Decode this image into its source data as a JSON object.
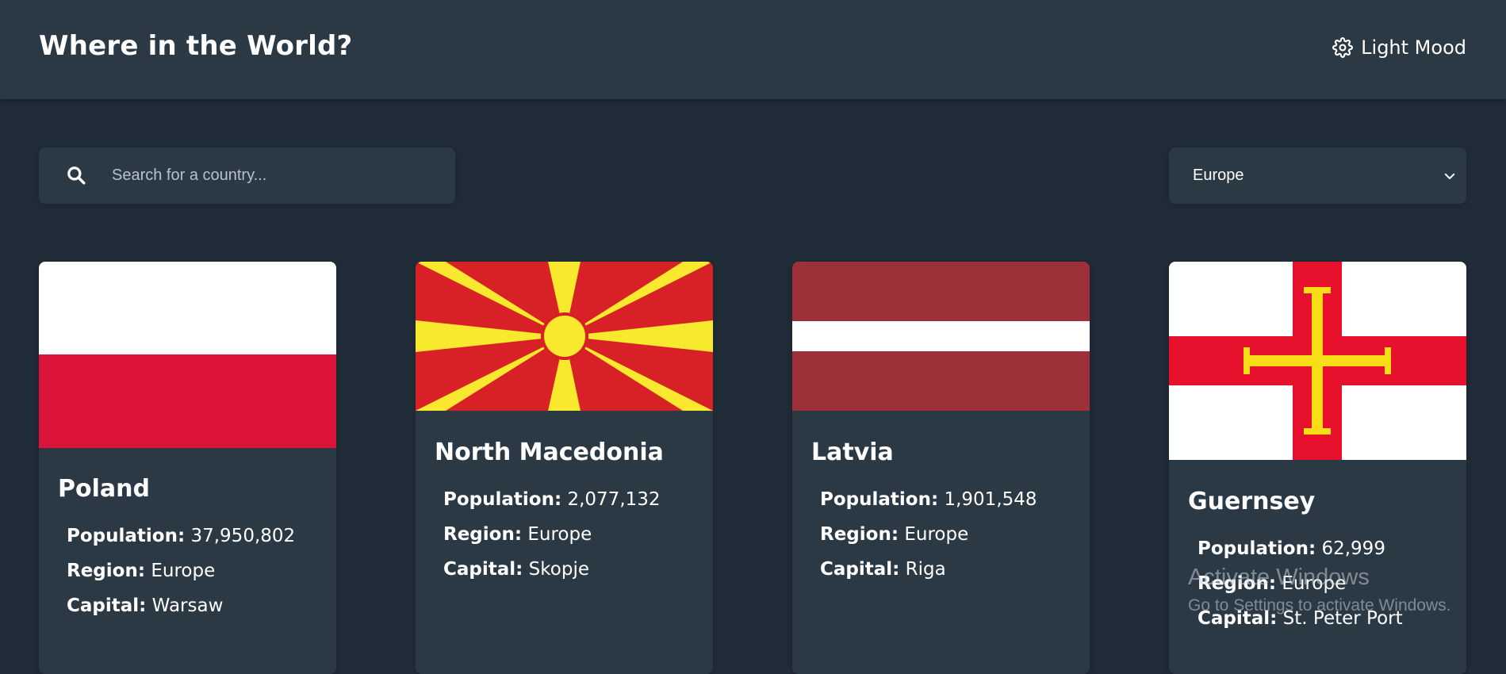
{
  "header": {
    "title": "Where in the World?",
    "mode_toggle_label": "Light Mood",
    "mode_toggle_icon": "gear-icon"
  },
  "search": {
    "placeholder": "Search for a country...",
    "value": "",
    "icon": "search-icon"
  },
  "filter": {
    "selected": "Europe",
    "icon": "chevron-down-icon"
  },
  "labels": {
    "population": "Population:",
    "region": "Region:",
    "capital": "Capital:"
  },
  "countries": [
    {
      "name": "Poland",
      "population": "37,950,802",
      "region": "Europe",
      "capital": "Warsaw"
    },
    {
      "name": "North Macedonia",
      "population": "2,077,132",
      "region": "Europe",
      "capital": "Skopje"
    },
    {
      "name": "Latvia",
      "population": "1,901,548",
      "region": "Europe",
      "capital": "Riga"
    },
    {
      "name": "Guernsey",
      "population": "62,999",
      "region": "Europe",
      "capital": "St. Peter Port"
    }
  ],
  "watermark": {
    "title": "Activate Windows",
    "subtitle": "Go to Settings to activate Windows."
  },
  "colors": {
    "background": "#202c37",
    "surface": "#2b3945",
    "text": "#ffffff"
  }
}
